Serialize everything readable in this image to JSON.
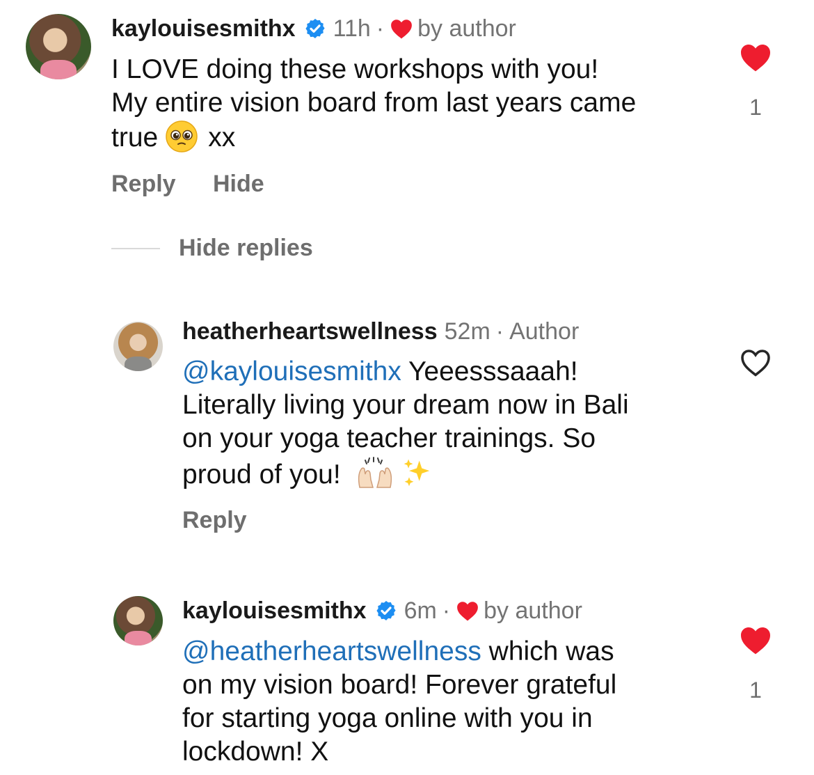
{
  "comments": [
    {
      "username": "kaylouisesmithx",
      "time": "11h",
      "author_like_text": "by author",
      "text_lines": [
        "I LOVE doing these workshops with you!",
        "My entire vision board from last years came",
        "true"
      ],
      "trailing_text": "xx",
      "like_count": "1",
      "actions": {
        "reply": "Reply",
        "hide": "Hide"
      },
      "replies_toggle": "Hide replies"
    },
    {
      "username": "heatherheartswellness",
      "time": "52m",
      "role": "Author",
      "mention": "@kaylouisesmithx",
      "text_lines": [
        " Yeeesssaaah!",
        "Literally living your dream now in Bali",
        "on your yoga teacher trainings. So",
        "proud of you!"
      ],
      "actions": {
        "reply": "Reply"
      }
    },
    {
      "username": "kaylouisesmithx",
      "time": "6m",
      "author_like_text": "by author",
      "mention": "@heatherheartswellness",
      "text_lines": [
        " which was",
        "on my vision board! Forever grateful",
        "for starting yoga online with you in",
        "lockdown! X"
      ],
      "like_count": "1"
    }
  ],
  "icons": {
    "verified": "verified-badge-icon",
    "heart_filled": "heart-filled-icon",
    "heart_outline": "heart-outline-icon",
    "emoji_pleading": "pleading-face-emoji",
    "emoji_raised_hands": "raised-hands-emoji",
    "emoji_sparkles": "sparkles-emoji"
  },
  "colors": {
    "heart": "#ee1d2f",
    "verified": "#1d8ef2",
    "mention": "#1f6fb8",
    "secondary_text": "#737373"
  }
}
